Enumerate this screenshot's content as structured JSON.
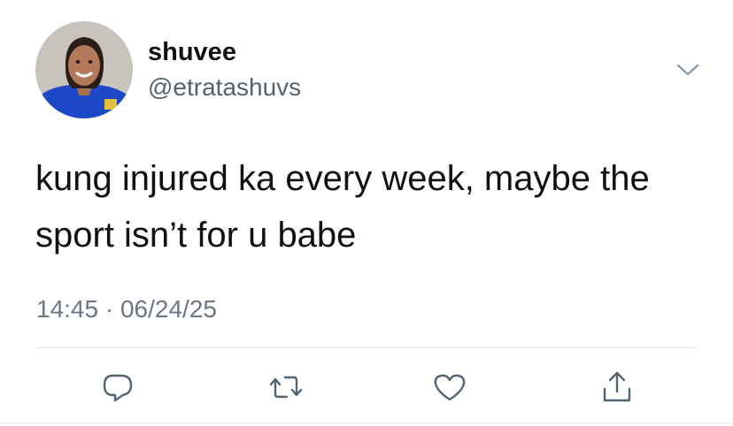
{
  "tweet": {
    "author": {
      "display_name": "shuvee",
      "handle": "@etratashuvs"
    },
    "text": "kung injured ka every week, maybe the sport isn’t for u babe",
    "time": "14:45",
    "separator": "·",
    "date": "06/24/25"
  },
  "actions": [
    {
      "icon": "reply-icon"
    },
    {
      "icon": "retweet-icon"
    },
    {
      "icon": "like-icon"
    },
    {
      "icon": "share-icon"
    }
  ],
  "colors": {
    "text_primary": "#111111",
    "text_secondary": "#536471",
    "icon": "#536471",
    "divider": "#dfe3e6"
  }
}
